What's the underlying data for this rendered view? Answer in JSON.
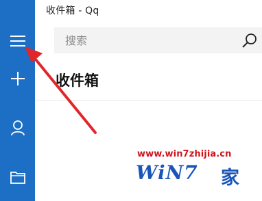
{
  "window": {
    "title": "收件箱 - Qq"
  },
  "sidebar": {
    "items": [
      {
        "name": "menu",
        "icon": "hamburger-icon"
      },
      {
        "name": "new",
        "icon": "plus-icon"
      },
      {
        "name": "account",
        "icon": "person-icon"
      },
      {
        "name": "folders",
        "icon": "folder-icon"
      }
    ]
  },
  "search": {
    "placeholder": "搜索",
    "value": "",
    "icon": "search-icon"
  },
  "main": {
    "heading": "收件箱"
  },
  "watermark": {
    "url": "www.win7zhijia.cn",
    "logo": "WiN7",
    "house": "家"
  },
  "colors": {
    "sidebar": "#1c6fc4",
    "search_bg": "#f3f3f3",
    "arrow": "#e1262b",
    "watermark_red": "#d0141b",
    "watermark_blue": "#1a56b8"
  }
}
